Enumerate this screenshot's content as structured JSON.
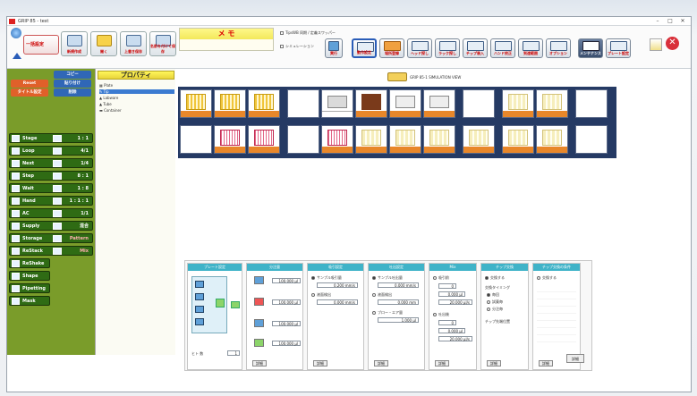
{
  "window": {
    "title": "GRIP 85 - test"
  },
  "toolbar": {
    "left_buttons": [
      {
        "label": "一括設定"
      },
      {
        "label": "新規作成"
      },
      {
        "label": "開く"
      },
      {
        "label": "上書き保存"
      },
      {
        "label": "名前を付けて保存"
      }
    ],
    "memo_title": "メ モ",
    "check_1": "TipsWB 同期 / 定義スワッパー",
    "check_2": "シミュレーション",
    "ribbon_buttons": [
      {
        "label": "実行"
      },
      {
        "label": "動作設定"
      },
      {
        "label": "場所登録"
      },
      {
        "label": "ヘッド探し"
      },
      {
        "label": "ラック探し"
      },
      {
        "label": "チップ装入"
      },
      {
        "label": "ハンド校正"
      },
      {
        "label": "到達範囲"
      },
      {
        "label": "オプション"
      },
      {
        "label": "メンテナンス"
      },
      {
        "label": "プレート設定"
      }
    ]
  },
  "left_panel": {
    "top_switches": [
      {
        "label": "コピー"
      },
      {
        "label": "Reset"
      },
      {
        "label": "貼り付け"
      },
      {
        "label": "タイトル設定"
      },
      {
        "label": "削除"
      }
    ],
    "items": [
      {
        "label": "Stage",
        "value": "1 : 1"
      },
      {
        "label": "Loop",
        "value": "4/1"
      },
      {
        "label": "Next",
        "value": "1/4"
      },
      {
        "label": "Step",
        "value": "8 : 1"
      },
      {
        "label": "Wait",
        "value": "1 : 8"
      },
      {
        "label": "Hand",
        "value": "1 : 1 : 1"
      },
      {
        "label": "AC",
        "value": "1/1"
      },
      {
        "label": "Supply",
        "value": "混合"
      },
      {
        "label": "Storage",
        "value": "Pattern"
      },
      {
        "label": "ReStack",
        "value": "Mix"
      },
      {
        "label": "ReShake",
        "value": ""
      },
      {
        "label": "Shape",
        "value": ""
      },
      {
        "label": "Pipetting",
        "value": ""
      },
      {
        "label": "Mask",
        "value": ""
      }
    ]
  },
  "properties": {
    "title": "プロパティ",
    "tree": [
      "Plate",
      "Tip",
      "Labware",
      "Tube",
      "Container"
    ]
  },
  "canvas": {
    "note": "GRIP 85-1 SIMULATION VIEW"
  },
  "detail": {
    "columns": [
      {
        "header": "プレート設定",
        "sub": "ヒト 数",
        "value": "1"
      },
      {
        "header": "分注量",
        "rows": [
          "100.000 µl",
          "100.000 µl",
          "100.000 µl",
          "100.000 µl"
        ],
        "button": "詳細"
      },
      {
        "header": "吸引設定",
        "opt1": "サンプル吸引量",
        "val1": "0.200 mm/s",
        "opt2": "液面検出",
        "val2": "0.000 mm/s",
        "button": "詳細"
      },
      {
        "header": "吐出設定",
        "opt1": "サンプル吐出量",
        "val1": "0.000 mm/s",
        "opt2": "液面検出",
        "val2": "0.000 mm",
        "opt3": "ブロー・エア量",
        "val3": "1.000 µl",
        "button": "詳細"
      },
      {
        "header": "Mix",
        "opt1": "吸引前",
        "rows": [
          "0",
          "0.000 µl",
          "20.000 µl/s"
        ],
        "opt2": "吐出後",
        "rows2": [
          "0",
          "0.000 µl",
          "20.000 µl/s"
        ],
        "button": "詳細"
      },
      {
        "header": "チップ交換",
        "opt1": "交換する",
        "sub": "交換タイミング",
        "r1": "毎回",
        "r2": "試薬毎",
        "r3": "分注毎",
        "sub2": "チップ先端位置",
        "button": "詳細"
      },
      {
        "header": "チップ交換の条件",
        "opt1": "交換する",
        "button": "詳細",
        "extra": "詳細"
      }
    ]
  },
  "colors": {
    "left_panel": "#7a9c2a",
    "item": "#2f6b14",
    "header_teal": "#3fb3c8",
    "grid_bg": "#253a64"
  }
}
